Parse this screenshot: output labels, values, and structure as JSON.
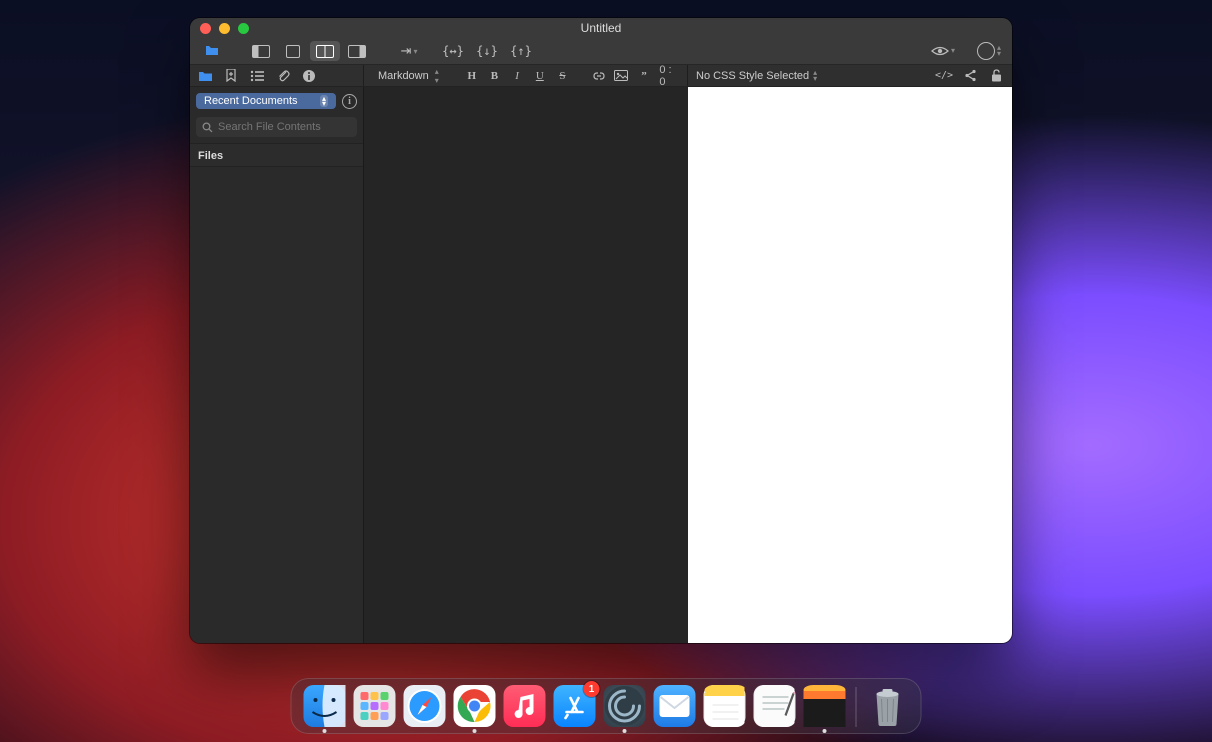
{
  "window": {
    "title": "Untitled"
  },
  "toolbar": {
    "layout_buttons": [
      "panel-left",
      "panel-single",
      "panel-split",
      "panel-right"
    ]
  },
  "sidebar": {
    "recent_label": "Recent Documents",
    "search_placeholder": "Search File Contents",
    "files_header": "Files"
  },
  "editor": {
    "syntax": "Markdown",
    "counter": "0 : 0"
  },
  "preview": {
    "css_label": "No CSS Style Selected"
  },
  "dock": {
    "appstore_badge": "1"
  }
}
